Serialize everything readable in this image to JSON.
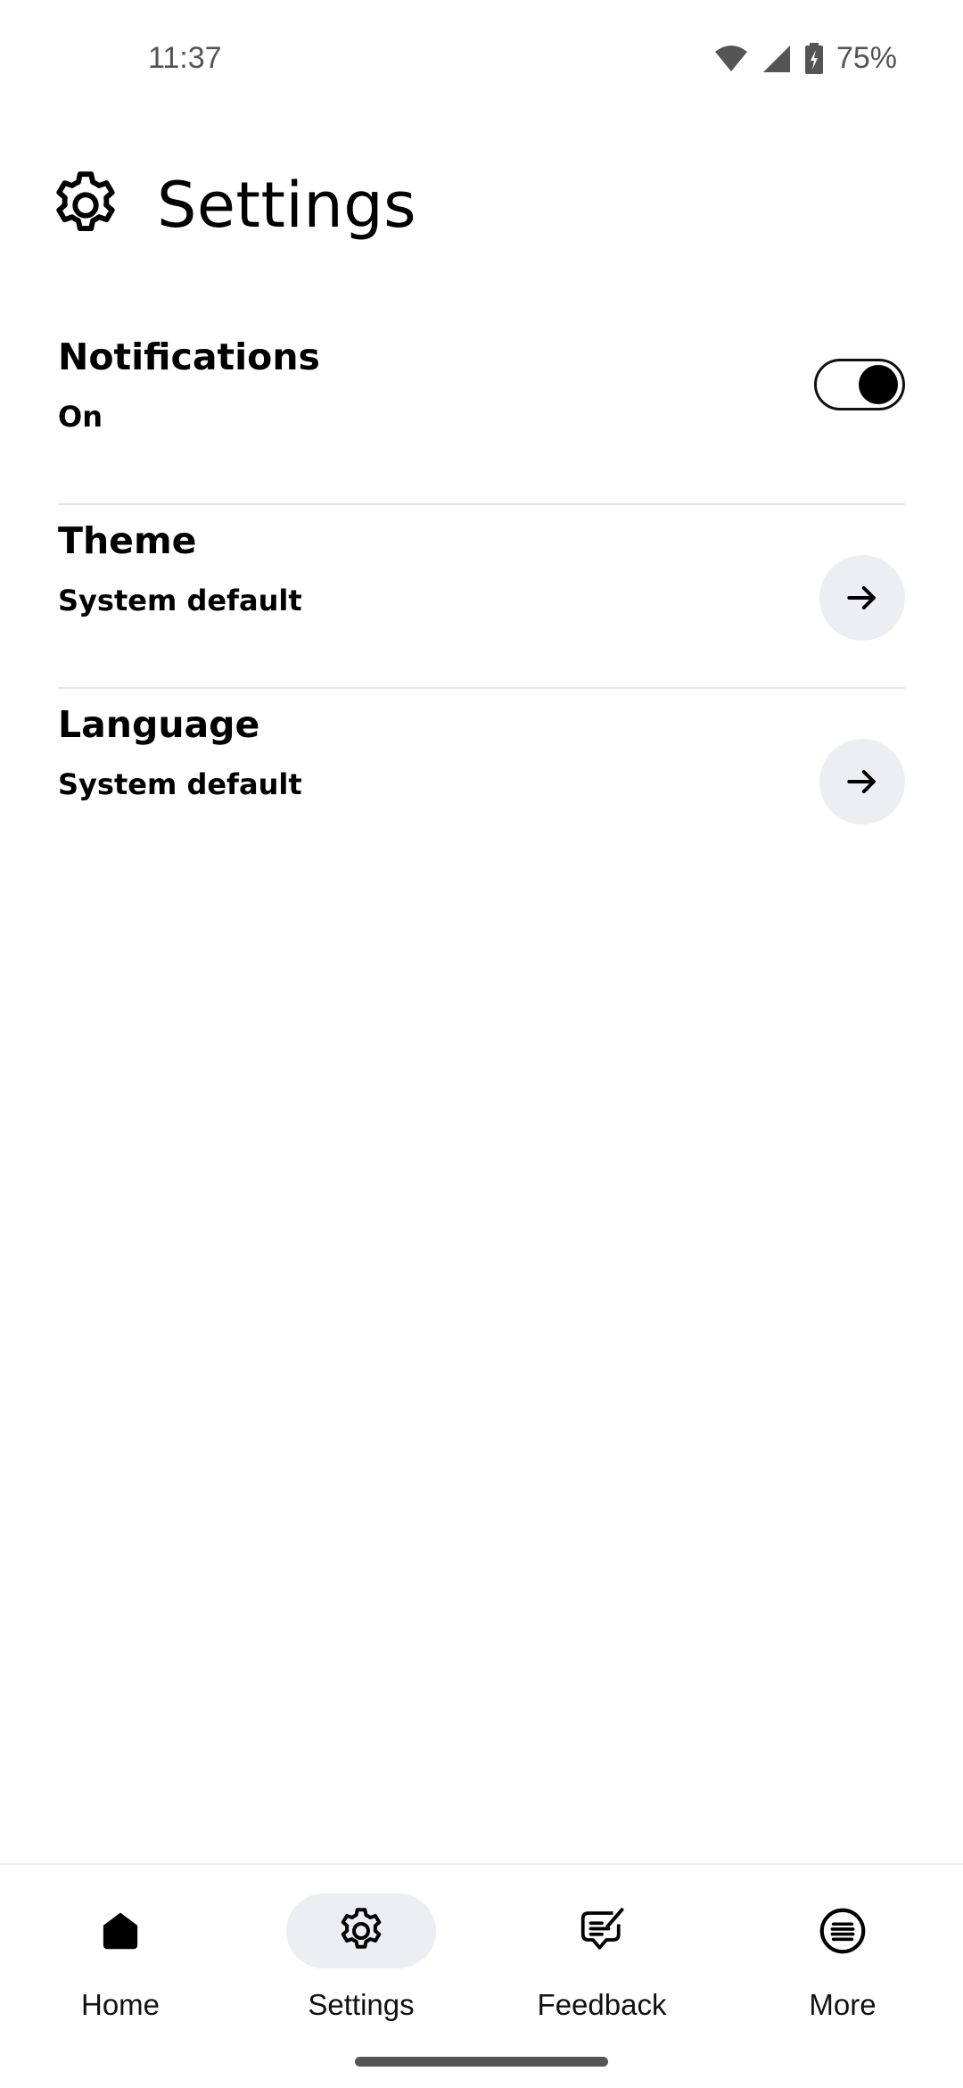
{
  "status_bar": {
    "time": "11:37",
    "battery": "75%",
    "icons": [
      "wifi-icon",
      "signal-icon",
      "battery-charging-icon"
    ]
  },
  "header": {
    "icon": "gear-icon",
    "title": "Settings"
  },
  "settings": [
    {
      "title": "Notifications",
      "value": "On",
      "control": "toggle",
      "toggle_on": true
    },
    {
      "title": "Theme",
      "value": "System default",
      "control": "arrow-right-icon"
    },
    {
      "title": "Language",
      "value": "System default",
      "control": "arrow-right-icon"
    }
  ],
  "bottom_nav": {
    "items": [
      {
        "label": "Home",
        "icon": "home-icon",
        "active": false
      },
      {
        "label": "Settings",
        "icon": "gear-icon",
        "active": true
      },
      {
        "label": "Feedback",
        "icon": "feedback-icon",
        "active": false
      },
      {
        "label": "More",
        "icon": "menu-circle-icon",
        "active": false
      }
    ]
  },
  "colors": {
    "active_pill": "#eceef1",
    "arrow_button_bg": "#eceef1",
    "divider": "#e6e6e6",
    "text": "#000000"
  }
}
